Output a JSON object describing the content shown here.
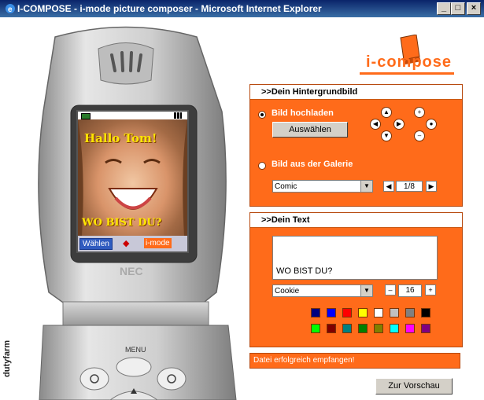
{
  "window": {
    "title": "I-COMPOSE - i-mode picture composer - Microsoft Internet Explorer",
    "buttons": [
      "_",
      "□",
      "×"
    ]
  },
  "phone": {
    "screen_top_text": "Hallo Tom!",
    "screen_bottom_text": "WO BIST DU?",
    "softkey_left": "Wählen",
    "softkey_right": "i-mode",
    "brand": "NEC",
    "menu_label": "MENU",
    "side_brand": "dutyfarm"
  },
  "logo": {
    "text": "i-compose"
  },
  "background_panel": {
    "heading": ">>Dein Hintergrundbild",
    "option_upload": "Bild hochladen",
    "upload_button": "Auswählen",
    "option_gallery": "Bild aus der Galerie",
    "gallery_select": "Comic",
    "gallery_counter": "1/8",
    "nav_icons": [
      "arrow-up-icon",
      "plus-icon",
      "arrow-left-icon",
      "arrow-right-icon",
      "arrow-down-icon",
      "minus-icon"
    ]
  },
  "text_panel": {
    "heading": ">>Dein Text",
    "text_value": "WO BIST DU?",
    "font_select": "Cookie",
    "size_value": "16",
    "minus_label": "–",
    "plus_label": "+",
    "colors_row1": [
      "#000080",
      "#0000ff",
      "#ff0000",
      "#ffff00",
      "#ffffff",
      "#c0c0c0",
      "#808080",
      "#000000"
    ],
    "colors_row2": [
      "#00ff00",
      "#800000",
      "#008080",
      "#008000",
      "#808000",
      "#00ffff",
      "#ff00ff",
      "#800080"
    ]
  },
  "status": {
    "message": "Datei erfolgreich empfangen!"
  },
  "preview_button": "Zur Vorschau",
  "colors": {
    "accent": "#ff6b1a"
  }
}
